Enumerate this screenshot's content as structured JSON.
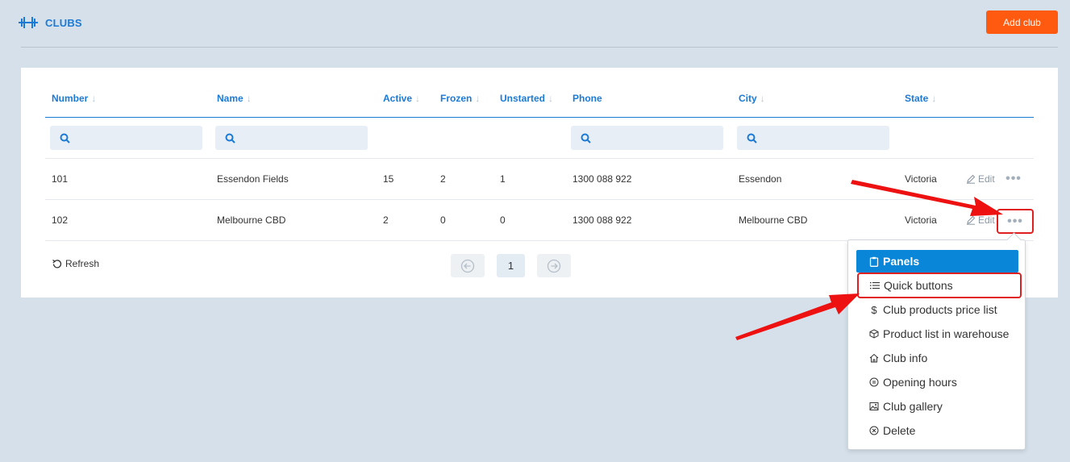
{
  "header": {
    "title": "CLUBS",
    "add_label": "Add club"
  },
  "table": {
    "columns": [
      {
        "label": "Number",
        "sortable": true
      },
      {
        "label": "Name",
        "sortable": true
      },
      {
        "label": "Active",
        "sortable": true
      },
      {
        "label": "Frozen",
        "sortable": true
      },
      {
        "label": "Unstarted",
        "sortable": true
      },
      {
        "label": "Phone",
        "sortable": false
      },
      {
        "label": "City",
        "sortable": true
      },
      {
        "label": "State",
        "sortable": true
      }
    ],
    "rows": [
      {
        "number": "101",
        "name": "Essendon Fields",
        "active": "15",
        "frozen": "2",
        "unstarted": "1",
        "phone": "1300 088 922",
        "city": "Essendon",
        "state": "Victoria"
      },
      {
        "number": "102",
        "name": "Melbourne CBD",
        "active": "2",
        "frozen": "0",
        "unstarted": "0",
        "phone": "1300 088 922",
        "city": "Melbourne CBD",
        "state": "Victoria"
      }
    ],
    "edit_label": "Edit",
    "more_label": "•••"
  },
  "footer": {
    "refresh_label": "Refresh",
    "current_page": "1"
  },
  "menu": {
    "items": [
      {
        "label": "Panels",
        "icon": "clipboard-icon"
      },
      {
        "label": "Quick buttons",
        "icon": "list-icon"
      },
      {
        "label": "Club products price list",
        "icon": "dollar-icon"
      },
      {
        "label": "Product list in warehouse",
        "icon": "box-icon"
      },
      {
        "label": "Club info",
        "icon": "home-icon"
      },
      {
        "label": "Opening hours",
        "icon": "clock-icon"
      },
      {
        "label": "Club gallery",
        "icon": "image-icon"
      },
      {
        "label": "Delete",
        "icon": "delete-icon"
      }
    ]
  },
  "colors": {
    "accent": "#1a7ad6",
    "add_button": "#ff5a10",
    "menu_primary": "#0a86d8",
    "highlight": "#e02020"
  }
}
